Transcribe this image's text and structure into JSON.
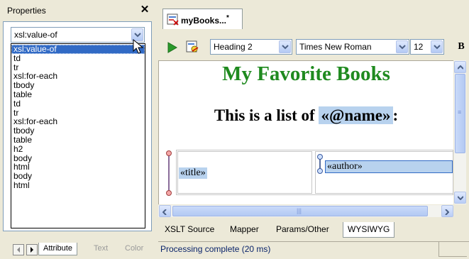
{
  "properties": {
    "title": "Properties",
    "close_glyph": "✕",
    "selected_element": "xsl:value-of",
    "element_options": [
      "xsl:value-of",
      "td",
      "tr",
      "xsl:for-each",
      "tbody",
      "table",
      "td",
      "tr",
      "xsl:for-each",
      "tbody",
      "table",
      "h2",
      "body",
      "html",
      "body",
      "html"
    ],
    "bottom_tabs": [
      "Attribute",
      "Text",
      "Color"
    ]
  },
  "document_tab": {
    "label": "myBooks...",
    "modified_marker": "*"
  },
  "toolbar": {
    "style_value": "Heading 2",
    "font_value": "Times New Roman",
    "size_value": "12",
    "bold_label": "B"
  },
  "document": {
    "heading": "My Favorite Books",
    "line_prefix": "This is a list of ",
    "line_field": "«@name»",
    "line_suffix": ":",
    "title_field": "«title»",
    "author_field": "«author»"
  },
  "view_tabs": [
    "XSLT Source",
    "Mapper",
    "Params/Other",
    "WYSIWYG"
  ],
  "active_view_tab": "WYSIWYG",
  "status": {
    "text": "Processing complete  (20 ms)"
  },
  "icons": {
    "close": "close-icon",
    "dropdown": "chevron-down-icon",
    "document": "xslt-document-icon",
    "run": "play-icon",
    "debug": "debug-icon"
  }
}
